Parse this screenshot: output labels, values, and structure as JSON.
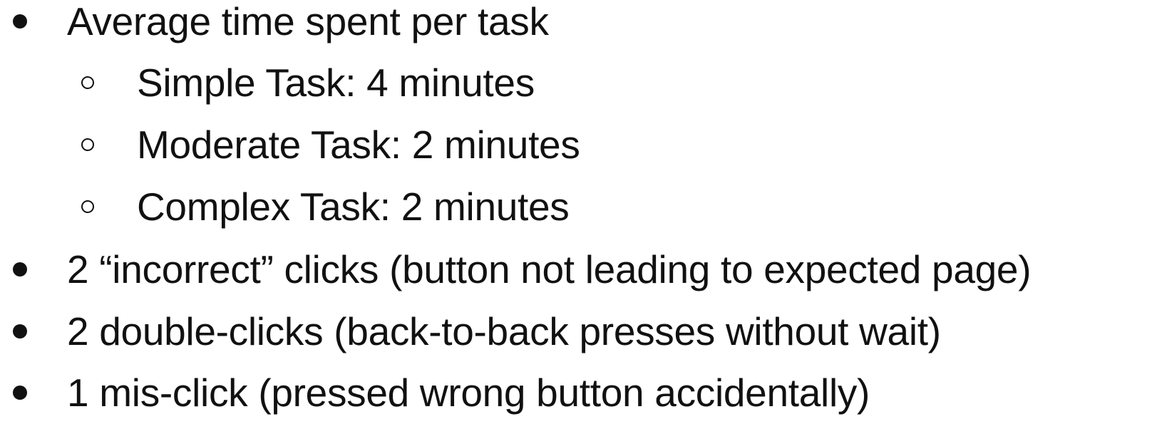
{
  "items": [
    {
      "label": "Average time spent per task"
    },
    {
      "label": "Simple Task: 4 minutes"
    },
    {
      "label": "Moderate Task: 2 minutes"
    },
    {
      "label": "Complex Task: 2 minutes"
    },
    {
      "label": "2 “incorrect” clicks (button not leading to expected page)"
    },
    {
      "label": "2 double-clicks (back-to-back presses without wait)"
    },
    {
      "label": "1 mis-click (pressed wrong button accidentally)"
    }
  ]
}
